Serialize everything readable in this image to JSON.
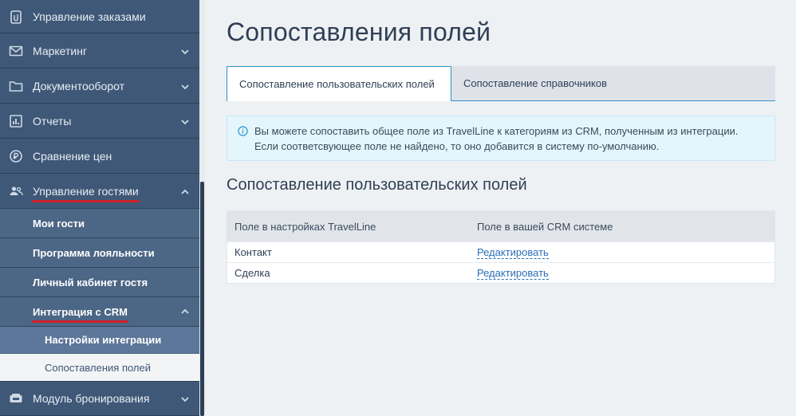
{
  "sidebar": {
    "items": [
      {
        "label": "Управление заказами",
        "icon": "clipboard-icon"
      },
      {
        "label": "Маркетинг",
        "icon": "mail-icon"
      },
      {
        "label": "Документооборот",
        "icon": "folder-icon"
      },
      {
        "label": "Отчеты",
        "icon": "report-icon"
      },
      {
        "label": "Сравнение цен",
        "icon": "price-compare-icon"
      },
      {
        "label": "Управление гостями",
        "icon": "guests-icon"
      }
    ],
    "guests_sub": [
      {
        "label": "Мои гости"
      },
      {
        "label": "Программа лояльности"
      },
      {
        "label": "Личный кабинет гостя"
      },
      {
        "label": "Интеграция с CRM"
      }
    ],
    "crm_sub": [
      {
        "label": "Настройки интеграции"
      },
      {
        "label": "Сопоставления полей"
      }
    ],
    "booking": {
      "label": "Модуль бронирования",
      "icon": "booking-icon"
    }
  },
  "main": {
    "title": "Сопоставления полей",
    "tabs": [
      {
        "label": "Сопоставление пользовательских полей"
      },
      {
        "label": "Сопоставление справочников"
      }
    ],
    "info_line1": "Вы можете сопоставить общее поле из TravelLine к категориям из CRM, полученным из интеграции.",
    "info_line2": "Если соответсвующее поле не найдено, то оно добавится в систему по-умолчанию.",
    "section_title": "Сопоставление пользовательских полей",
    "table": {
      "headers": [
        "Поле в настройках TravelLine",
        "Поле в вашей CRM системе"
      ],
      "rows": [
        {
          "field": "Контакт",
          "action": "Редактировать"
        },
        {
          "field": "Сделка",
          "action": "Редактировать"
        }
      ]
    }
  }
}
